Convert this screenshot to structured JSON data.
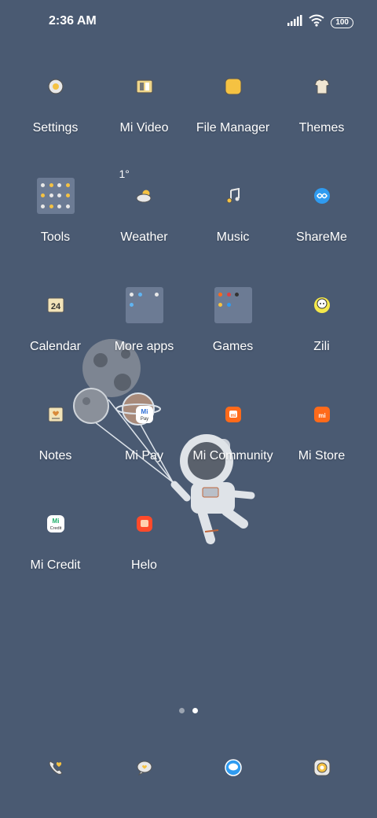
{
  "status": {
    "time": "2:36 AM",
    "battery": "100"
  },
  "apps": [
    {
      "label": "Settings",
      "icon": "settings-icon"
    },
    {
      "label": "Mi Video",
      "icon": "mi-video-icon"
    },
    {
      "label": "File Manager",
      "icon": "file-manager-icon"
    },
    {
      "label": "Themes",
      "icon": "themes-icon"
    },
    {
      "label": "Tools",
      "icon": "tools-folder-icon"
    },
    {
      "label": "Weather",
      "icon": "weather-icon",
      "temp": "1°"
    },
    {
      "label": "Music",
      "icon": "music-icon"
    },
    {
      "label": "ShareMe",
      "icon": "shareme-icon"
    },
    {
      "label": "Calendar",
      "icon": "calendar-icon",
      "day": "24"
    },
    {
      "label": "More apps",
      "icon": "more-apps-folder-icon"
    },
    {
      "label": "Games",
      "icon": "games-folder-icon"
    },
    {
      "label": "Zili",
      "icon": "zili-icon"
    },
    {
      "label": "Notes",
      "icon": "notes-icon"
    },
    {
      "label": "Mi Pay",
      "icon": "mi-pay-icon",
      "badge": "Pay"
    },
    {
      "label": "Mi Community",
      "icon": "mi-community-icon"
    },
    {
      "label": "Mi Store",
      "icon": "mi-store-icon"
    },
    {
      "label": "Mi Credit",
      "icon": "mi-credit-icon",
      "badge": "Credit"
    },
    {
      "label": "Helo",
      "icon": "helo-icon"
    }
  ],
  "dock": [
    {
      "icon": "phone-icon"
    },
    {
      "icon": "messages-icon"
    },
    {
      "icon": "browser-icon"
    },
    {
      "icon": "camera-icon"
    }
  ],
  "pages": {
    "count": 2,
    "active": 2
  },
  "colors": {
    "background": "#4a5a72",
    "accent_yellow": "#f5c242",
    "accent_orange": "#ff6a1a",
    "accent_blue": "#2f9bf0"
  }
}
